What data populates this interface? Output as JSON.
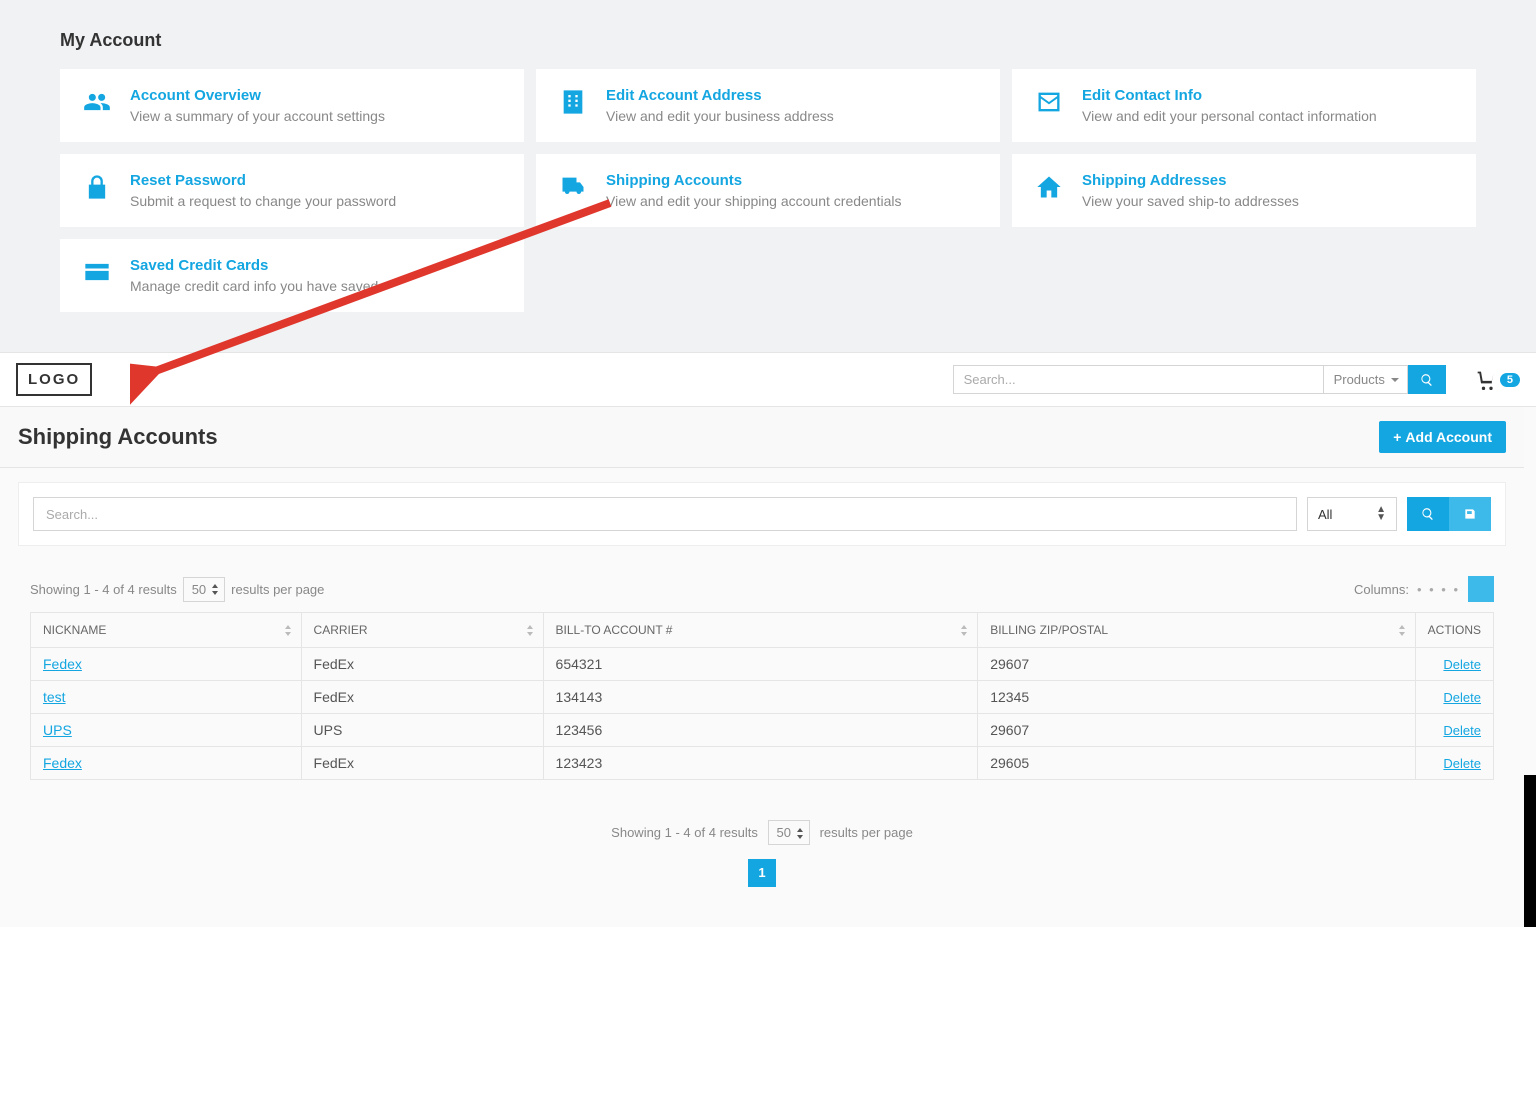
{
  "my_account": {
    "title": "My Account",
    "cards": [
      {
        "title": "Account Overview",
        "desc": "View a summary of your account settings"
      },
      {
        "title": "Edit Account Address",
        "desc": "View and edit your business address"
      },
      {
        "title": "Edit Contact Info",
        "desc": "View and edit your personal contact information"
      },
      {
        "title": "Reset Password",
        "desc": "Submit a request to change your password"
      },
      {
        "title": "Shipping Accounts",
        "desc": "View and edit your shipping account credentials"
      },
      {
        "title": "Shipping Addresses",
        "desc": "View your saved ship-to addresses"
      },
      {
        "title": "Saved Credit Cards",
        "desc": "Manage credit card info you have saved"
      }
    ]
  },
  "header": {
    "logo": "LOGO",
    "search_placeholder": "Search...",
    "search_scope": "Products",
    "cart_count": "5"
  },
  "page": {
    "title": "Shipping Accounts",
    "add_btn": "Add Account"
  },
  "filter": {
    "search_placeholder": "Search...",
    "select_label": "All"
  },
  "results": {
    "showing_text": "Showing 1 - 4 of 4 results",
    "per_page": "50",
    "per_page_suffix": "results per page",
    "columns_label": "Columns:",
    "columns_dots": "• • • •"
  },
  "table": {
    "headers": {
      "nickname": "NICKNAME",
      "carrier": "CARRIER",
      "billto": "BILL-TO ACCOUNT #",
      "zip": "BILLING ZIP/POSTAL",
      "actions": "ACTIONS"
    },
    "rows": [
      {
        "nickname": "Fedex",
        "carrier": "FedEx",
        "billto": "654321",
        "zip": "29607",
        "action": "Delete"
      },
      {
        "nickname": "test",
        "carrier": "FedEx",
        "billto": "134143",
        "zip": "12345",
        "action": "Delete"
      },
      {
        "nickname": "UPS",
        "carrier": "UPS",
        "billto": "123456",
        "zip": "29607",
        "action": "Delete"
      },
      {
        "nickname": "Fedex",
        "carrier": "FedEx",
        "billto": "123423",
        "zip": "29605",
        "action": "Delete"
      }
    ]
  },
  "footer": {
    "showing_text": "Showing 1 - 4 of 4 results",
    "per_page": "50",
    "per_page_suffix": "results per page",
    "current_page": "1"
  }
}
